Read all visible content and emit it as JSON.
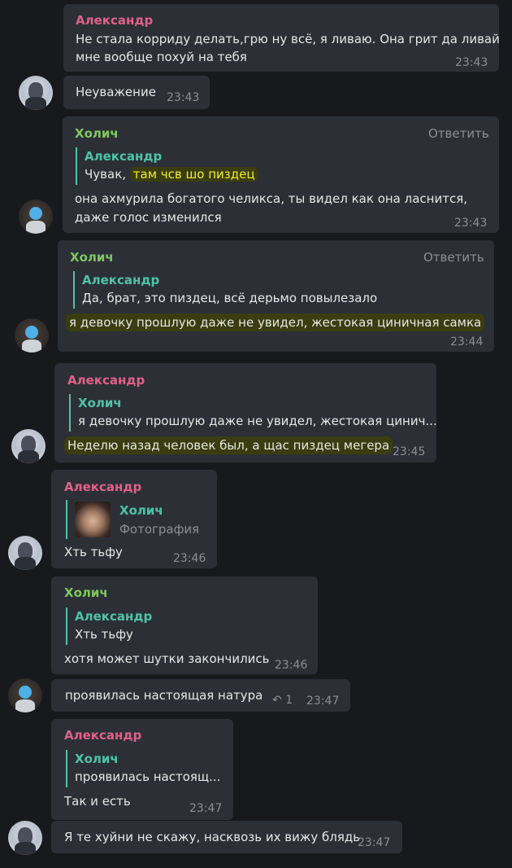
{
  "messages": [
    {
      "sender": "Александр",
      "line1": "Не стала корриду делать,грю ну всё, я ливаю. Она грит да ливай",
      "line2": "мне вообще похуй на тебя",
      "time": "23:43"
    },
    {
      "text": "Неуважение",
      "time": "23:43"
    },
    {
      "sender": "Холич",
      "reply_label": "Ответить",
      "quote_name": "Александр",
      "quote_plain": "Чувак, ",
      "quote_highlight": "там чсв шо пиздец",
      "line1": "она ахмурила богатого челикса, ты видел как она ласнится,",
      "line2": "даже голос изменился",
      "time": "23:43"
    },
    {
      "sender": "Холич",
      "reply_label": "Ответить",
      "quote_name": "Александр",
      "quote_text": "Да, брат, это пиздец, всё дерьмо повылезало",
      "highlight": "я девочку прошлую даже не увидел, жестокая циничная самка",
      "time": "23:44"
    },
    {
      "sender": "Александр",
      "quote_name": "Холич",
      "quote_text": "я девочку прошлую даже не увидел, жестокая цинич...",
      "highlight": "Неделю назад человек был, а щас пиздец мегера",
      "time": "23:45"
    },
    {
      "sender": "Александр",
      "quote_name": "Холич",
      "quote_text": "Фотография",
      "text": "Хть тьфу",
      "time": "23:46"
    },
    {
      "sender": "Холич",
      "quote_name": "Александр",
      "quote_text": "Хть тьфу",
      "text": "хотя может шутки закончились",
      "time": "23:46"
    },
    {
      "text": "проявилась настоящая натура",
      "reply_count": "1",
      "time": "23:47"
    },
    {
      "sender": "Александр",
      "quote_name": "Холич",
      "quote_text": "проявилась настоящ...",
      "text": "Так и есть",
      "time": "23:47"
    },
    {
      "text": "Я те хуйни не скажу, насквозь их вижу блядь",
      "time": "23:47"
    }
  ],
  "colors": {
    "alexander": "#e0618a",
    "holich": "#7ec85f",
    "quote_bar": "#4fc3a7",
    "highlight_bg": "#3b3d10",
    "highlight_text": "#f2ef2e"
  }
}
